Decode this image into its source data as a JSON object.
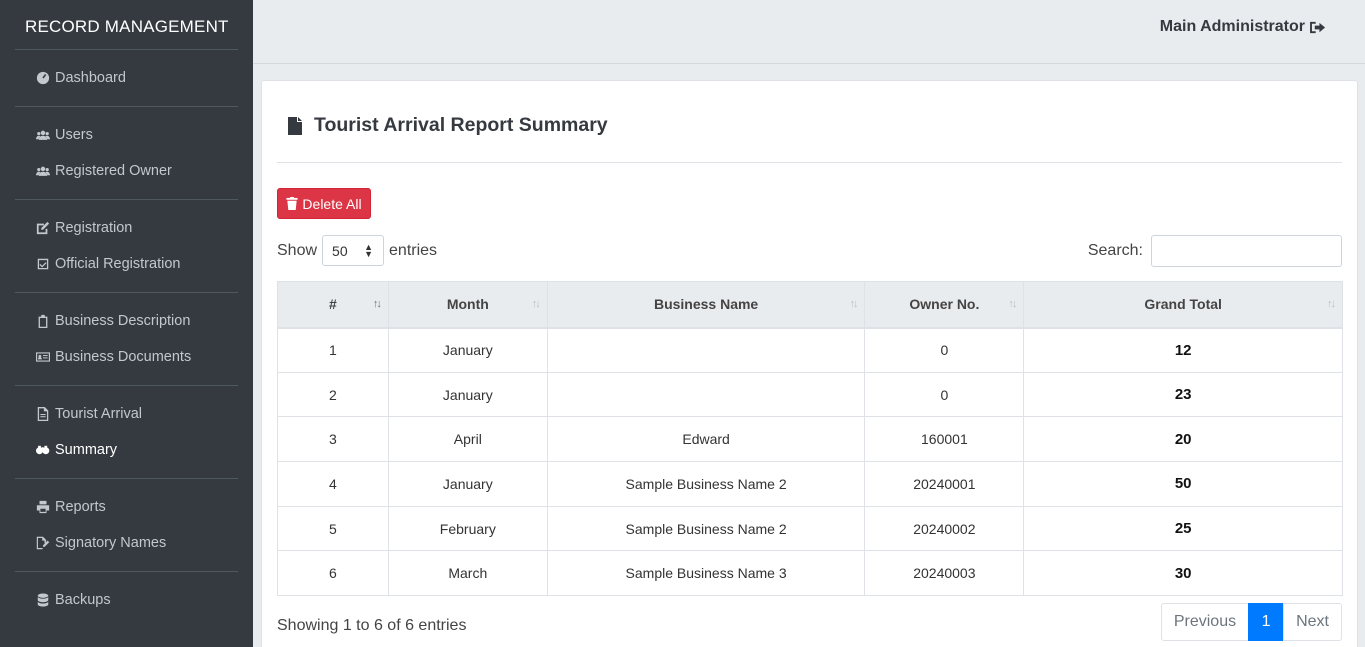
{
  "sidebar": {
    "brand": "RECORD MANAGEMENT",
    "groups": [
      {
        "items": [
          {
            "label": "Dashboard",
            "icon": "dashboard-icon"
          }
        ]
      },
      {
        "items": [
          {
            "label": "Users",
            "icon": "users-icon"
          },
          {
            "label": "Registered Owner",
            "icon": "users-icon"
          }
        ]
      },
      {
        "items": [
          {
            "label": "Registration",
            "icon": "edit-icon"
          },
          {
            "label": "Official Registration",
            "icon": "check-square-icon"
          }
        ]
      },
      {
        "items": [
          {
            "label": "Business Description",
            "icon": "clipboard-icon"
          },
          {
            "label": "Business Documents",
            "icon": "id-card-icon"
          }
        ]
      },
      {
        "items": [
          {
            "label": "Tourist Arrival",
            "icon": "file-icon"
          },
          {
            "label": "Summary",
            "icon": "binoculars-icon",
            "active": true
          }
        ]
      },
      {
        "items": [
          {
            "label": "Reports",
            "icon": "print-icon"
          },
          {
            "label": "Signatory Names",
            "icon": "file-signature-icon"
          }
        ]
      },
      {
        "items": [
          {
            "label": "Backups",
            "icon": "database-icon"
          }
        ]
      }
    ]
  },
  "header": {
    "user": "Main Administrator",
    "logout_icon": "sign-out-icon"
  },
  "card": {
    "title": "Tourist Arrival Report Summary",
    "title_icon": "file-icon",
    "delete_label": "Delete All",
    "length_show": "Show",
    "length_value": "50",
    "length_entries": "entries",
    "search_label": "Search:",
    "search_value": "",
    "columns": [
      "#",
      "Month",
      "Business Name",
      "Owner No.",
      "Grand Total"
    ],
    "rows": [
      [
        "1",
        "January",
        "",
        "0",
        "12"
      ],
      [
        "2",
        "January",
        "",
        "0",
        "23"
      ],
      [
        "3",
        "April",
        "Edward",
        "160001",
        "20"
      ],
      [
        "4",
        "January",
        "Sample Business Name 2",
        "20240001",
        "50"
      ],
      [
        "5",
        "February",
        "Sample Business Name 2",
        "20240002",
        "25"
      ],
      [
        "6",
        "March",
        "Sample Business Name 3",
        "20240003",
        "30"
      ]
    ],
    "info": "Showing 1 to 6 of 6 entries",
    "pager": {
      "previous": "Previous",
      "current": "1",
      "next": "Next"
    }
  },
  "colors": {
    "sidebar": "#343a40",
    "danger": "#dc3545",
    "primary": "#007bff"
  }
}
